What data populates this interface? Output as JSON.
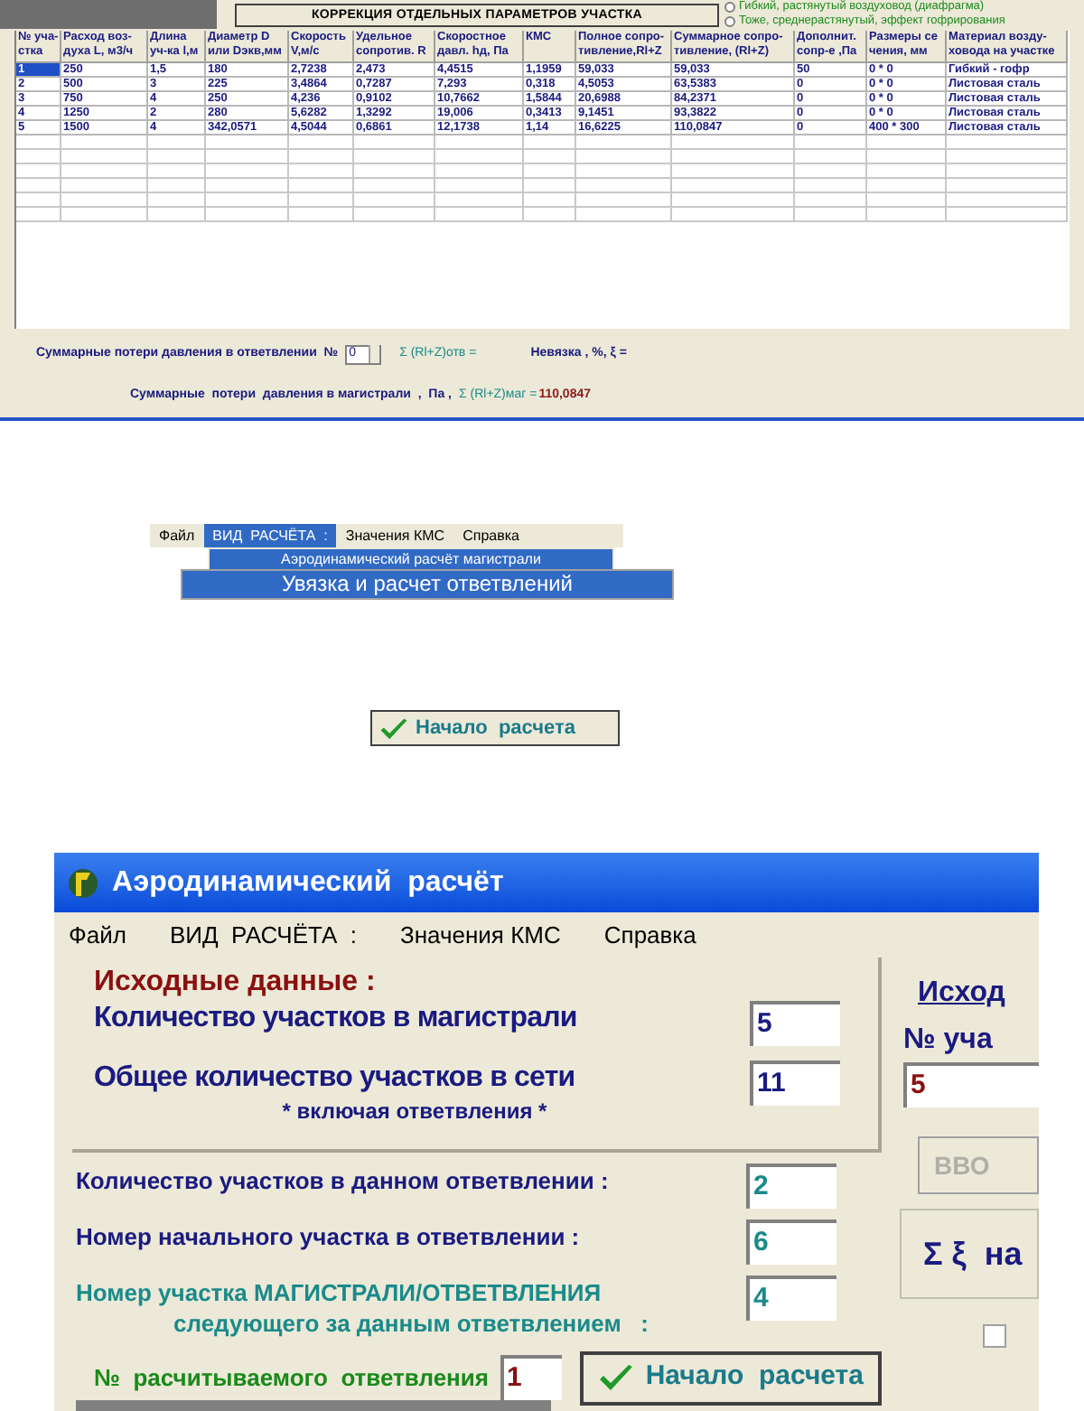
{
  "grid_window": {
    "correction_button": "КОРРЕКЦИЯ  ОТДЕЛЬНЫХ  ПАРАМЕТРОВ  УЧАСТКА",
    "options": [
      {
        "label": "Гибкий, растянутый воздуховод (диафрагма)",
        "selected": false
      },
      {
        "label": "Тоже, среднерастянутый, эффект гофрирования",
        "selected": false
      }
    ],
    "table": {
      "columns": [
        "№ уча-\nстка",
        "Расход воз-\nдуха L, м3/ч",
        "Длина\nуч-ка l,м",
        "Диаметр D\nили Dэкв,мм",
        "Скорость\nV,м/с",
        "Удельное\nсопротив. R",
        "Скоростное\nдавл. hд, Па",
        "КМС",
        "Полное сопро-\nтивление,Rl+Z",
        "Суммарное сопро-\nтивление, (Rl+Z)",
        "Дополнит.\nсопр-е ,Па",
        "Размеры се\nчения, мм",
        "Материал возду-\nховода на участке"
      ],
      "rows": [
        {
          "selected": true,
          "cells": [
            "1",
            "250",
            "1,5",
            "180",
            "2,7238",
            "2,473",
            "4,4515",
            "1,1959",
            "59,033",
            "59,033",
            "50",
            "0 * 0",
            "Гибкий - гофр"
          ]
        },
        {
          "selected": false,
          "cells": [
            "2",
            "500",
            "3",
            "225",
            "3,4864",
            "0,7287",
            "7,293",
            "0,318",
            "4,5053",
            "63,5383",
            "0",
            "0 * 0",
            "Листовая сталь"
          ]
        },
        {
          "selected": false,
          "cells": [
            "3",
            "750",
            "4",
            "250",
            "4,236",
            "0,9102",
            "10,7662",
            "1,5844",
            "20,6988",
            "84,2371",
            "0",
            "0 * 0",
            "Листовая сталь"
          ]
        },
        {
          "selected": false,
          "cells": [
            "4",
            "1250",
            "2",
            "280",
            "5,6282",
            "1,3292",
            "19,006",
            "0,3413",
            "9,1451",
            "93,3822",
            "0",
            "0 * 0",
            "Листовая сталь"
          ]
        },
        {
          "selected": false,
          "cells": [
            "5",
            "1500",
            "4",
            "342,0571",
            "4,5044",
            "0,6861",
            "12,1738",
            "1,14",
            "16,6225",
            "110,0847",
            "0",
            "400 * 300",
            "Листовая сталь"
          ]
        }
      ]
    },
    "branch_loss": {
      "label": "Суммарные потери давления в ответвлении  №",
      "spinner_value": "0",
      "sum_label": "Σ (Rl+Z)отв =",
      "mismatch_label": "Невязка , %, ξ ="
    },
    "main_loss": {
      "label": "Суммарные  потери  давления в магистрали  ,  Па ,",
      "sum_label": "Σ (Rl+Z)маг =",
      "value": "110,0847"
    }
  },
  "menu_snippet": {
    "menu": [
      {
        "label": "Файл",
        "selected": false
      },
      {
        "label": "ВИД  РАСЧЁТА  :",
        "selected": true
      },
      {
        "label": "Значения КМС",
        "selected": false
      },
      {
        "label": "Справка",
        "selected": false
      }
    ],
    "dropdown": [
      {
        "label": "Аэродинамический расчёт магистрали",
        "selected": true
      },
      {
        "label": "Увязка и расчет ответвлений",
        "selected": true
      }
    ]
  },
  "start_button_snippet": {
    "label": "Начало  расчета"
  },
  "main_window": {
    "title": "Аэродинамический  расчёт",
    "menu": [
      "Файл",
      "ВИД  РАСЧЁТА  :",
      "Значения КМС",
      "Справка"
    ],
    "initial_data": {
      "heading": "Исходные данные :",
      "fields": [
        {
          "label": "Количество участков в магистрали",
          "value": "5"
        },
        {
          "label": "Общее количество участков в сети",
          "note": "* включая ответвления *",
          "value": "11"
        }
      ]
    },
    "branch_fields": [
      {
        "kind": "plain",
        "label": "Количество участков в данном ответвлении :",
        "value": "2"
      },
      {
        "kind": "plain",
        "label": "Номер начального участка в ответвлении :",
        "value": "6"
      },
      {
        "kind": "accent",
        "label": "Номер участка МАГИСТРАЛИ/ОТВЕТВЛЕНИЯ",
        "note": "следующего за данным ответвлением   :",
        "value": "4"
      }
    ],
    "branch_number": {
      "label": "№  расчитываемого  ответвления",
      "value": "1"
    },
    "start_button": "Начало  расчета",
    "right_panel": {
      "heading": "Исход",
      "label": "№ уча",
      "value": "5",
      "input_button": {
        "label": "ВВО",
        "disabled": true
      },
      "sum_button": "Σ ξ  на",
      "checkbox": {
        "checked": false
      }
    }
  }
}
